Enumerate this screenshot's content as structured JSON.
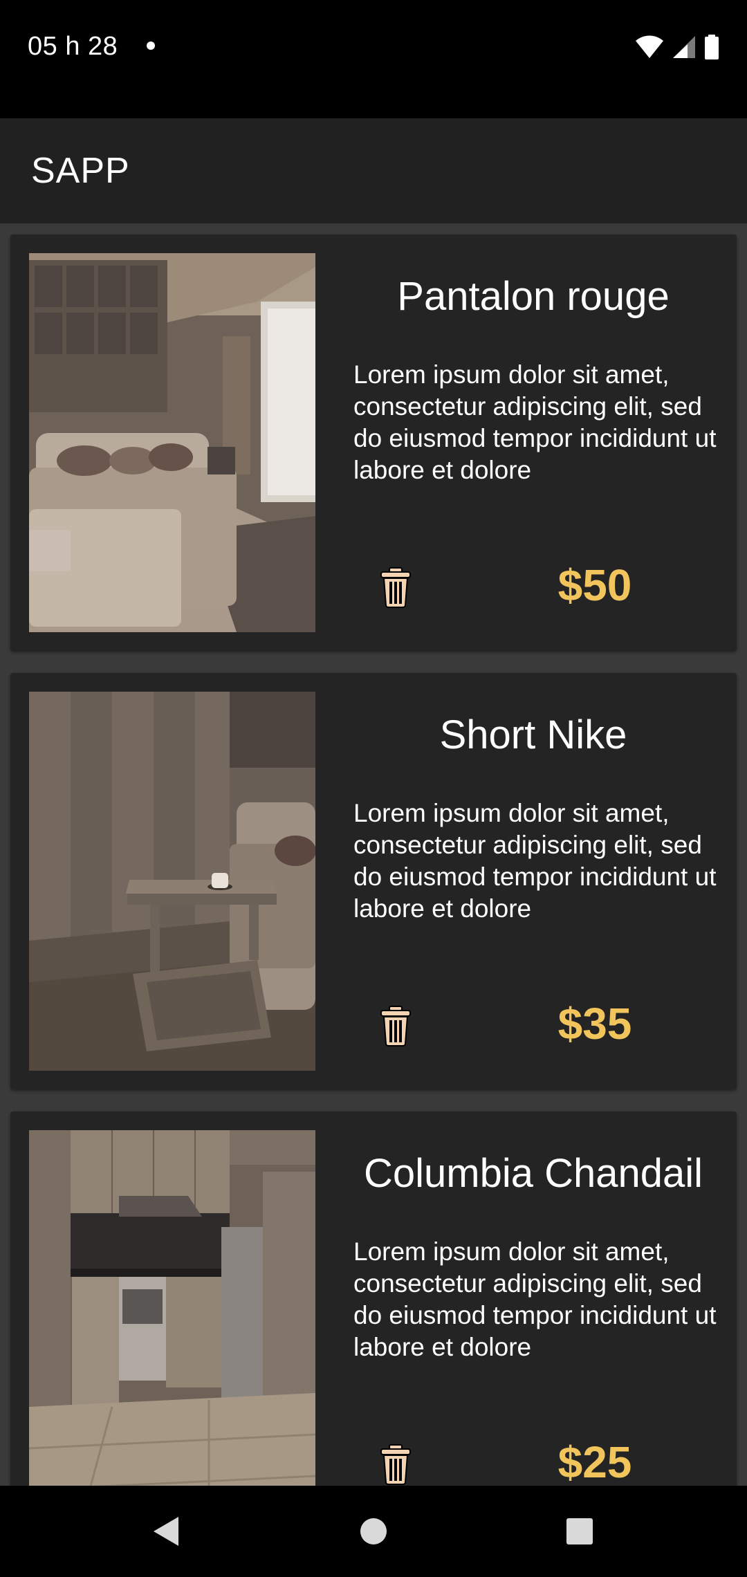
{
  "status_bar": {
    "time": "05 h 28",
    "icons": [
      "dot-icon",
      "wifi-icon",
      "signal-icon",
      "battery-icon"
    ]
  },
  "app_bar": {
    "title": "SAPP"
  },
  "products": [
    {
      "name": "Pantalon rouge",
      "description": "Lorem ipsum dolor sit amet, consectetur adipiscing elit, sed do eiusmod tempor incididunt ut labore et dolore",
      "price": "$50",
      "image": "living-room-sofa-image"
    },
    {
      "name": "Short Nike",
      "description": "Lorem ipsum dolor sit amet, consectetur adipiscing elit, sed do eiusmod tempor incididunt ut labore et dolore",
      "price": "$35",
      "image": "side-table-coffee-image"
    },
    {
      "name": "Columbia Chandail",
      "description": "Lorem ipsum dolor sit amet, consectetur adipiscing elit, sed do eiusmod tempor incididunt ut labore et dolore",
      "price": "$25",
      "image": "kitchen-image"
    }
  ],
  "nav_bar": {
    "icons": [
      "back-icon",
      "home-icon",
      "recents-icon"
    ]
  },
  "colors": {
    "price": "#f2c55c",
    "card_background": "#242424",
    "list_background": "#3a3a3a",
    "app_bar": "#212121",
    "delete_icon": "#f3d3b2"
  }
}
